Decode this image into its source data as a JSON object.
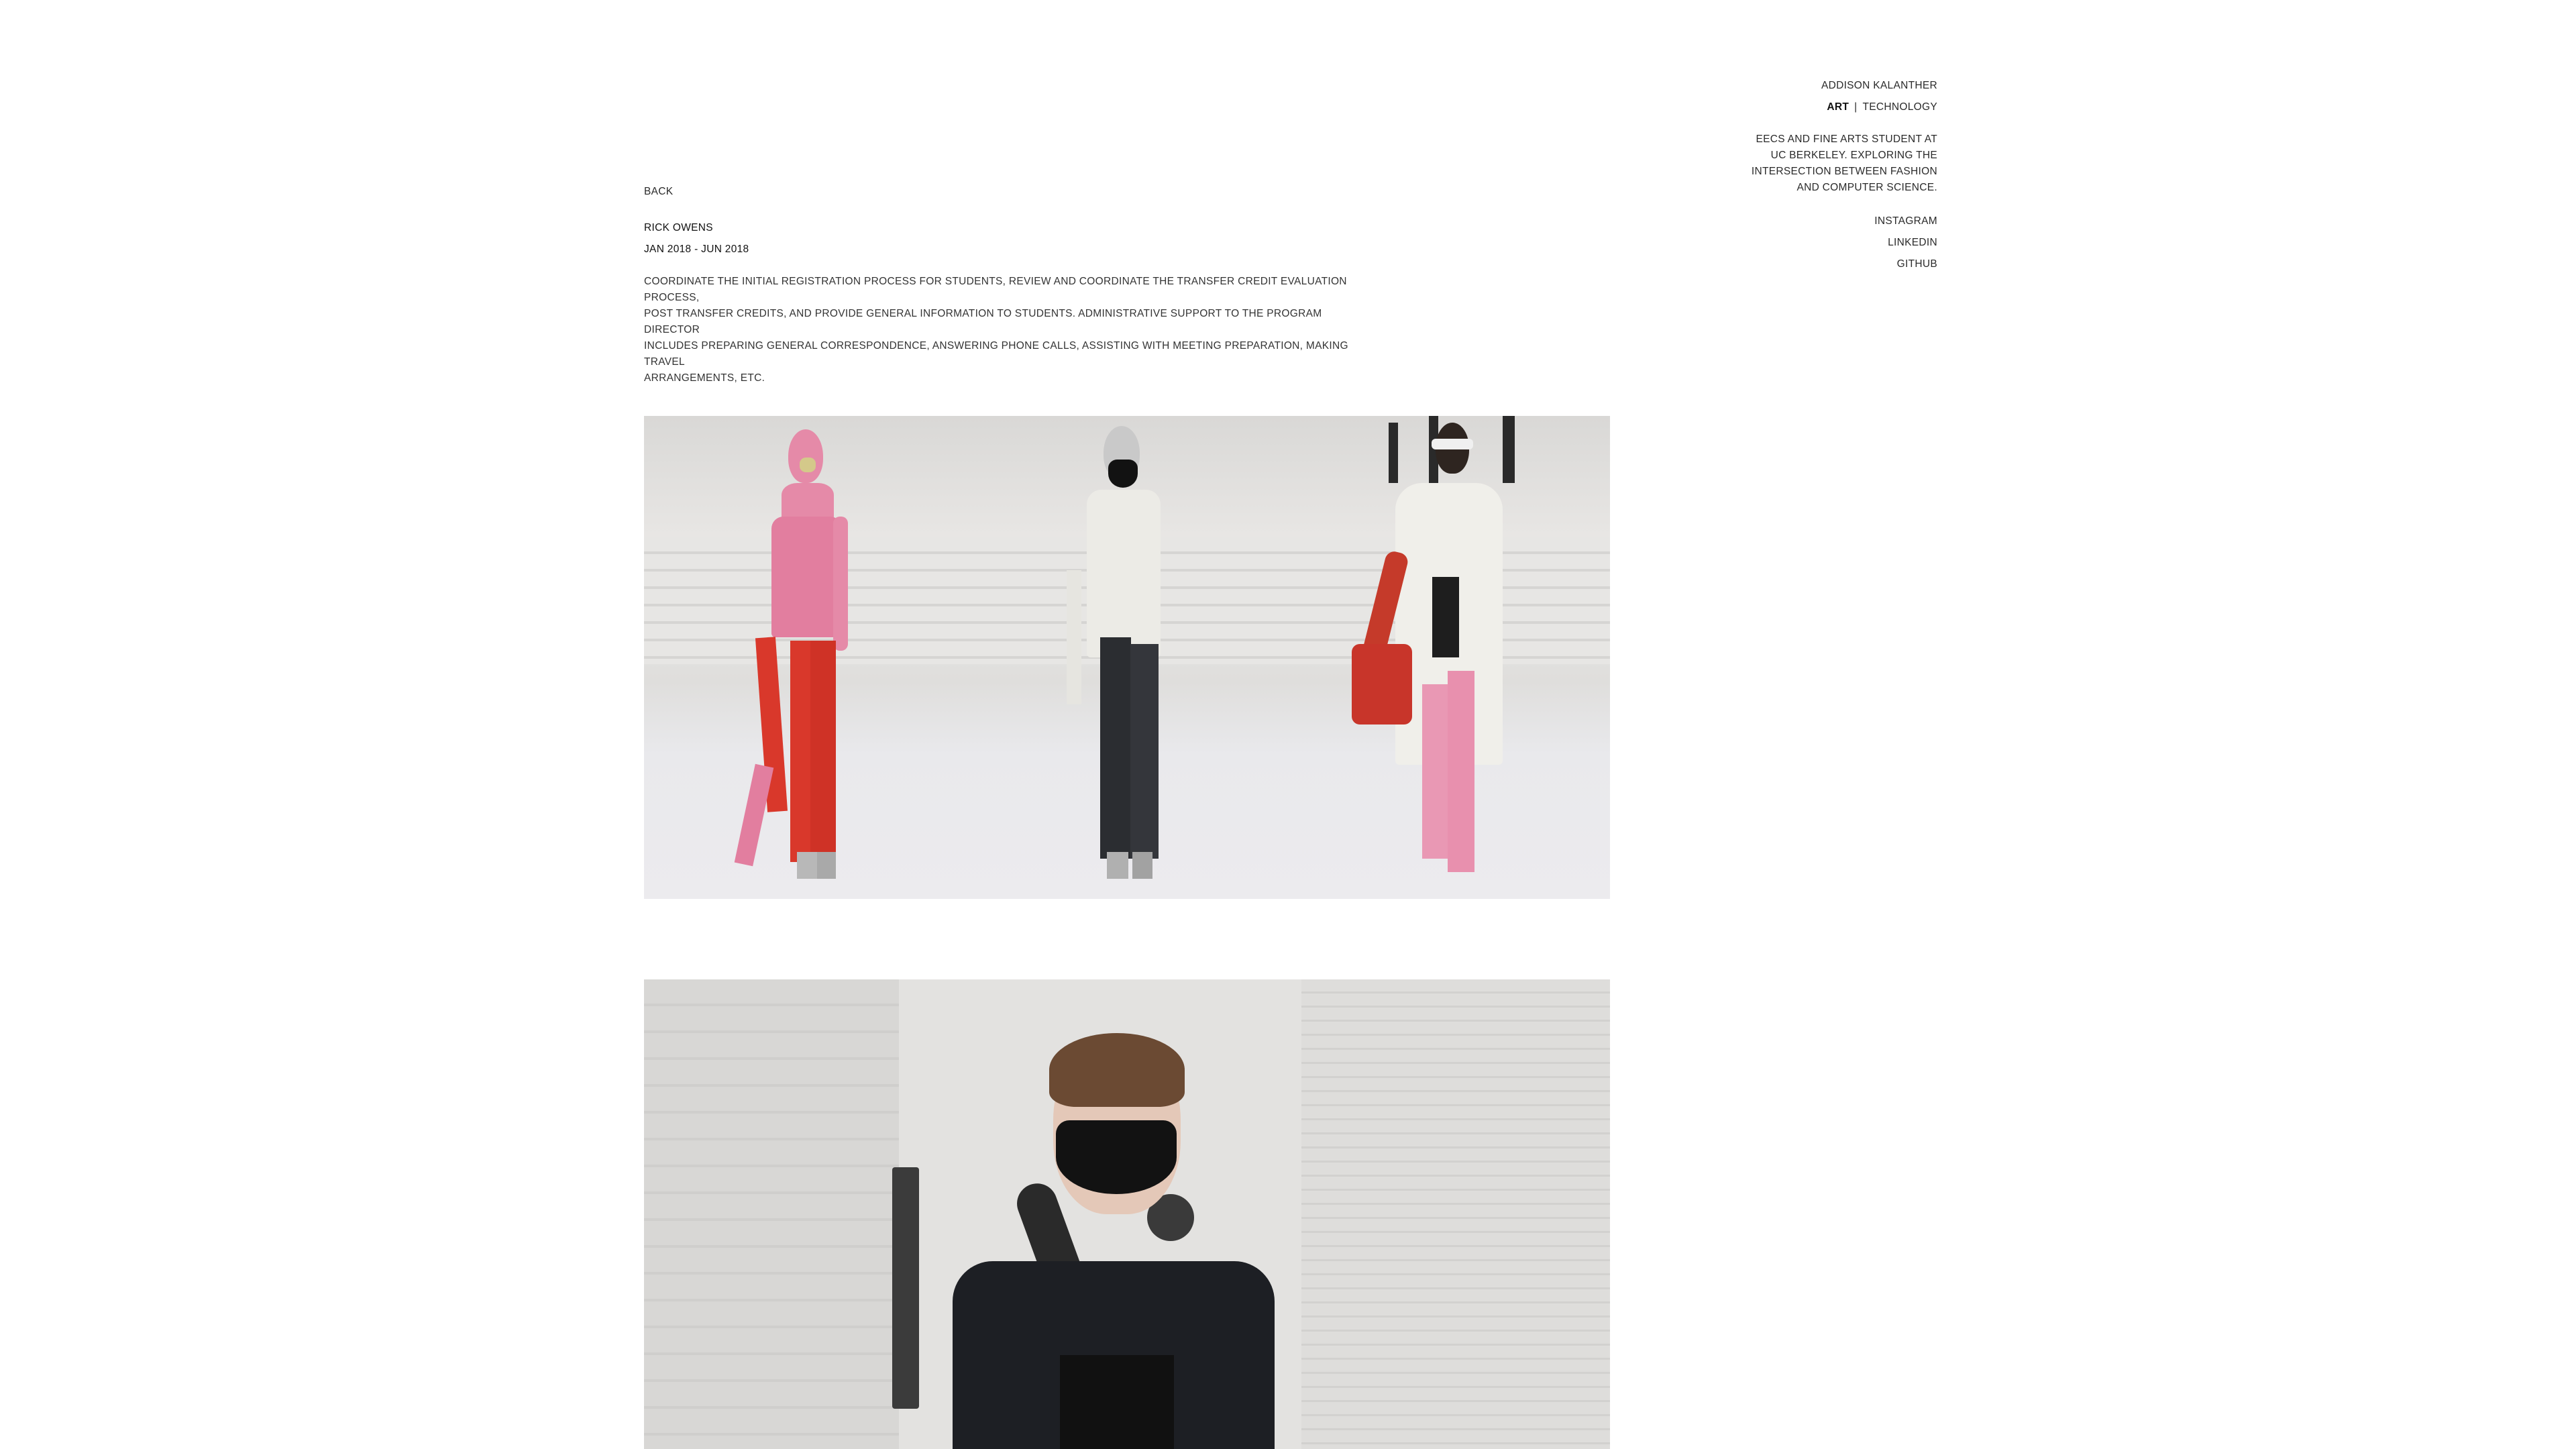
{
  "sidebar": {
    "name": "ADDISON KALANTHER",
    "nav": {
      "art": "ART",
      "separator": "|",
      "technology": "TECHNOLOGY"
    },
    "bio": [
      "EECS AND FINE ARTS STUDENT AT",
      "UC BERKELEY. EXPLORING THE",
      "INTERSECTION BETWEEN FASHION",
      "AND COMPUTER SCIENCE."
    ],
    "social": {
      "instagram": "INSTAGRAM",
      "linkedin": "LINKEDIN",
      "github": "GITHUB"
    }
  },
  "content": {
    "back": "BACK",
    "title": "RICK OWENS",
    "date": "JAN 2018 - JUN 2018",
    "description": [
      "COORDINATE THE INITIAL REGISTRATION PROCESS FOR STUDENTS, REVIEW AND COORDINATE THE TRANSFER CREDIT EVALUATION PROCESS,",
      "POST TRANSFER CREDITS, AND PROVIDE GENERAL INFORMATION TO STUDENTS. ADMINISTRATIVE SUPPORT TO THE PROGRAM DIRECTOR",
      "INCLUDES PREPARING GENERAL CORRESPONDENCE, ANSWERING PHONE CALLS, ASSISTING WITH MEETING PREPARATION, MAKING TRAVEL",
      "ARRANGEMENTS, ETC."
    ]
  },
  "colors": {
    "pink": "#e58aa8",
    "red": "#d9382b",
    "leather": "#2b2d31",
    "ivory": "#ecebe6",
    "mask": "#121212"
  }
}
